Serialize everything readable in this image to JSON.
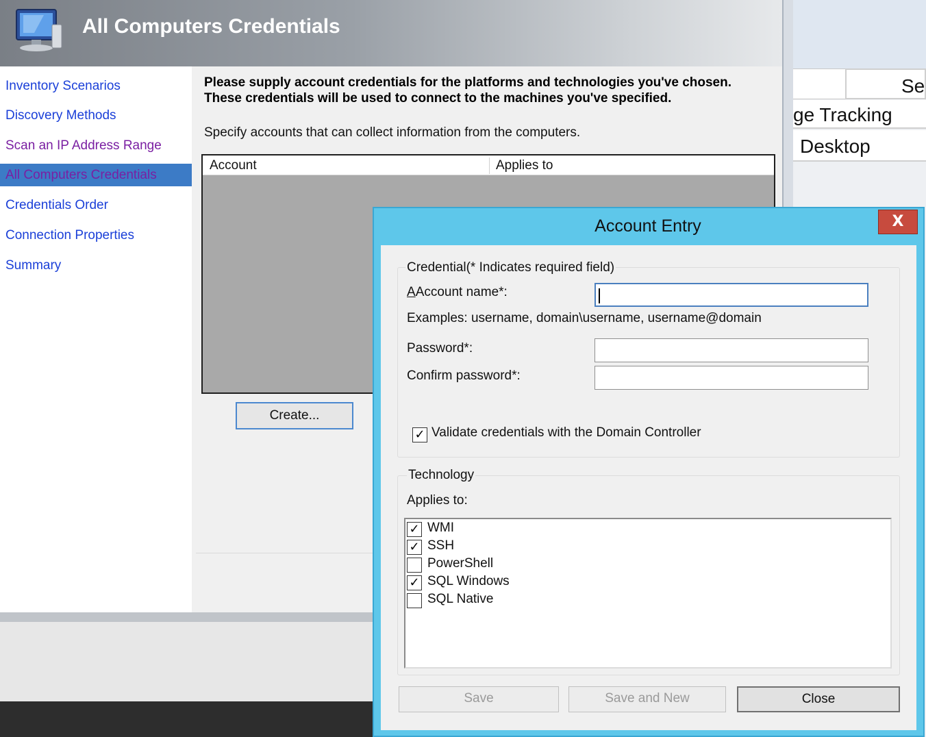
{
  "background_window": {
    "header_col_label": "Ser",
    "rows": [
      "ge Tracking",
      "Desktop"
    ]
  },
  "wizard": {
    "title": "All Computers Credentials",
    "nav": [
      {
        "label": "Inventory Scenarios",
        "state": "normal"
      },
      {
        "label": "Discovery Methods",
        "state": "normal"
      },
      {
        "label": "Scan an IP Address Range",
        "state": "visited"
      },
      {
        "label": "All Computers Credentials",
        "state": "active"
      },
      {
        "label": "Credentials Order",
        "state": "normal"
      },
      {
        "label": "Connection Properties",
        "state": "normal"
      },
      {
        "label": "Summary",
        "state": "normal"
      }
    ],
    "intro_line1": "Please supply account credentials for the platforms and technologies you've chosen.",
    "intro_line2": "These credentials will be used to connect to the machines you've specified.",
    "instruction": "Specify accounts that can collect information from the computers.",
    "grid_columns": [
      "Account",
      "Applies to"
    ],
    "create_button": "Create..."
  },
  "dialog": {
    "title": "Account Entry",
    "close_glyph": "X",
    "credential_group": "Credential(* Indicates required field)",
    "account_name_label": "Account name*:",
    "account_name_value": "",
    "examples": "Examples: username, domain\\username, username@domain",
    "password_label": "Password*:",
    "confirm_password_label": "Confirm password*:",
    "validate_label": "Validate credentials with the Domain Controller",
    "validate_checked": true,
    "technology_group": "Technology",
    "applies_to_label": "Applies to:",
    "technologies": [
      {
        "label": "WMI",
        "checked": true
      },
      {
        "label": "SSH",
        "checked": true
      },
      {
        "label": "PowerShell",
        "checked": false
      },
      {
        "label": "SQL Windows",
        "checked": true
      },
      {
        "label": "SQL Native",
        "checked": false
      }
    ],
    "buttons": {
      "save": "Save",
      "save_and_new": "Save and New",
      "close": "Close"
    }
  },
  "colors": {
    "nav_link": "#1a3fd8",
    "nav_visited": "#7a1fa2",
    "nav_active_bg": "#3c7bc6",
    "dialog_frame": "#5ec7ea",
    "close_button": "#c74b3e"
  }
}
